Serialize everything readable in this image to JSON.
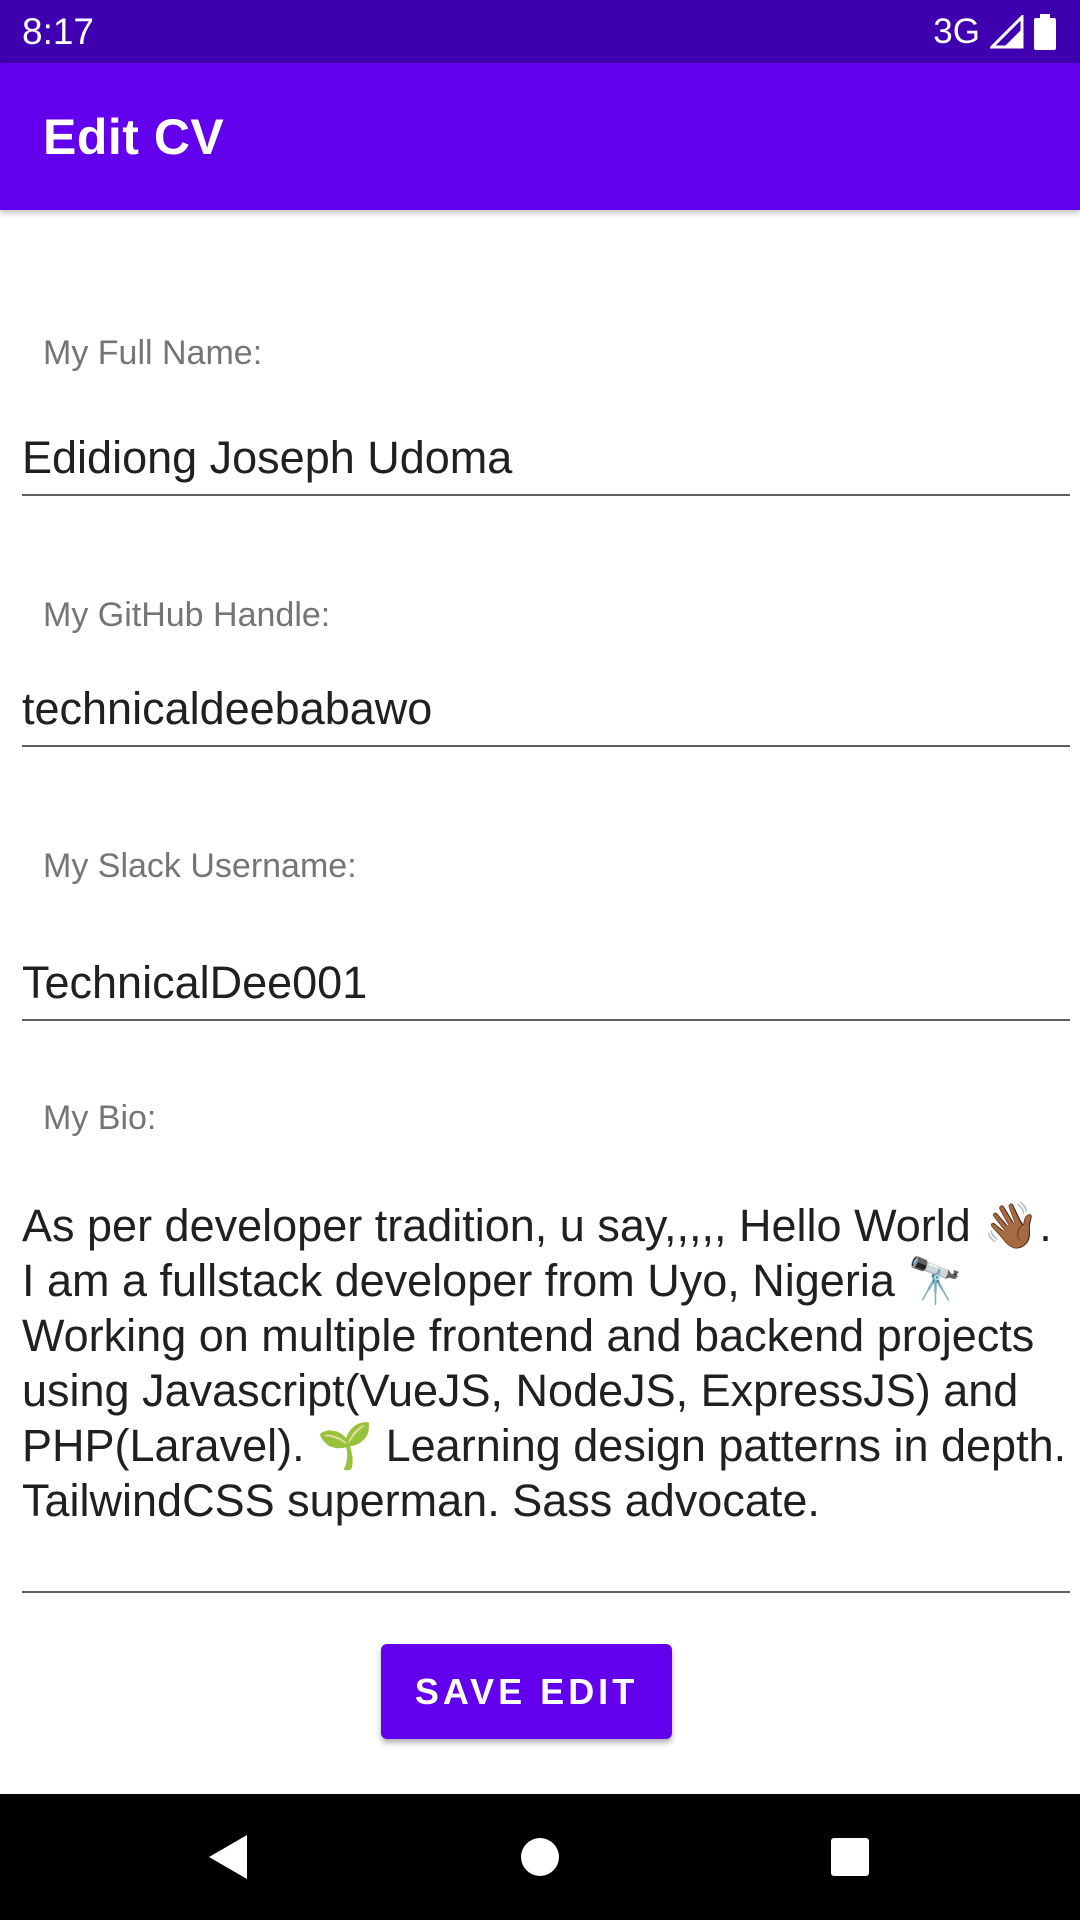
{
  "status_bar": {
    "time": "8:17",
    "network": "3G",
    "icons": [
      "signal-icon",
      "battery-icon"
    ]
  },
  "app_bar": {
    "title": "Edit CV",
    "color": "#6200ee"
  },
  "form": {
    "full_name": {
      "label": "My Full Name:",
      "value": "Edidiong Joseph Udoma"
    },
    "github": {
      "label": "My GitHub Handle:",
      "value": "technicaldeebabawo"
    },
    "slack": {
      "label": "My Slack Username:",
      "value": "TechnicalDee001"
    },
    "bio": {
      "label": "My Bio:",
      "value": "As per developer tradition, u say,,,,, Hello World 👋🏾. I am a fullstack developer from Uyo, Nigeria 🔭 Working on multiple frontend and backend projects using Javascript(VueJS, NodeJS, ExpressJS) and PHP(Laravel). 🌱 Learning design patterns in depth. TailwindCSS superman. Sass advocate."
    },
    "save_label": "SAVE EDIT"
  },
  "nav_bar": {
    "icons": [
      "back-icon",
      "home-icon",
      "recents-icon"
    ]
  }
}
